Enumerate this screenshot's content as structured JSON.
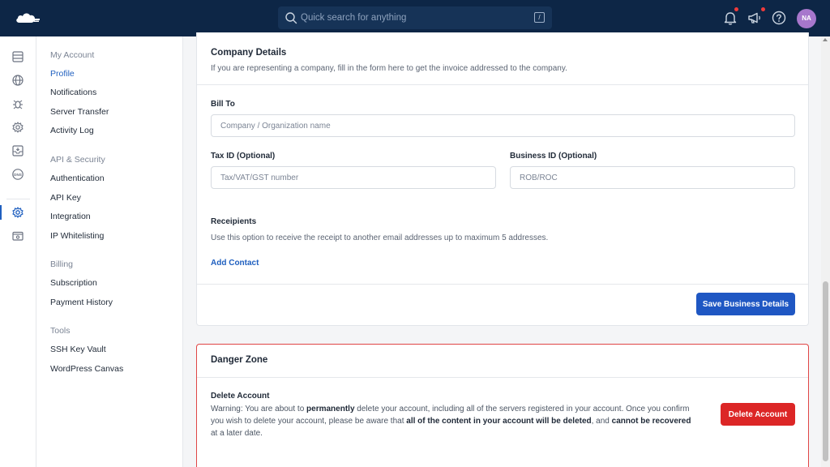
{
  "search": {
    "placeholder": "Quick search for anything",
    "shortcut": "/"
  },
  "user": {
    "initials": "NA"
  },
  "colors": {
    "topbar": "#0d2646",
    "accent": "#1f5fbf",
    "danger": "#dc2626",
    "notification": "#ef3b3b",
    "avatar": "#a777cc"
  },
  "rail_icons": [
    "servers-icon",
    "globe-icon",
    "bug-icon",
    "gear-badge-icon",
    "inbox-icon",
    "dns-icon",
    "settings-gear-icon",
    "billing-icon"
  ],
  "nav": {
    "groups": [
      {
        "title": "My Account",
        "items": [
          "Profile",
          "Notifications",
          "Server Transfer",
          "Activity Log"
        ]
      },
      {
        "title": "API & Security",
        "items": [
          "Authentication",
          "API Key",
          "Integration",
          "IP Whitelisting"
        ]
      },
      {
        "title": "Billing",
        "items": [
          "Subscription",
          "Payment History"
        ]
      },
      {
        "title": "Tools",
        "items": [
          "SSH Key Vault",
          "WordPress Canvas"
        ]
      }
    ],
    "active": "Profile"
  },
  "company": {
    "title": "Company Details",
    "subtitle": "If you are representing a company, fill in the form here to get the invoice addressed to the company.",
    "bill_to_label": "Bill To",
    "bill_to_placeholder": "Company / Organization name",
    "tax_id_label": "Tax ID (Optional)",
    "tax_id_placeholder": "Tax/VAT/GST number",
    "business_id_label": "Business ID (Optional)",
    "business_id_placeholder": "ROB/ROC",
    "recipients_label": "Receipients",
    "recipients_help": "Use this option to receive the receipt to another email addresses up to maximum 5 addresses.",
    "add_contact": "Add Contact",
    "save_button": "Save Business Details"
  },
  "danger": {
    "title": "Danger Zone",
    "delete_heading": "Delete Account",
    "warning_parts": [
      "Warning: You are about to ",
      "permanently",
      " delete your account, including all of the servers registered in your account. Once you confirm you wish to delete your account, please be aware that ",
      "all of the content in your account will be deleted",
      ", and ",
      "cannot be recovered",
      " at a later date."
    ],
    "delete_button": "Delete Account"
  }
}
